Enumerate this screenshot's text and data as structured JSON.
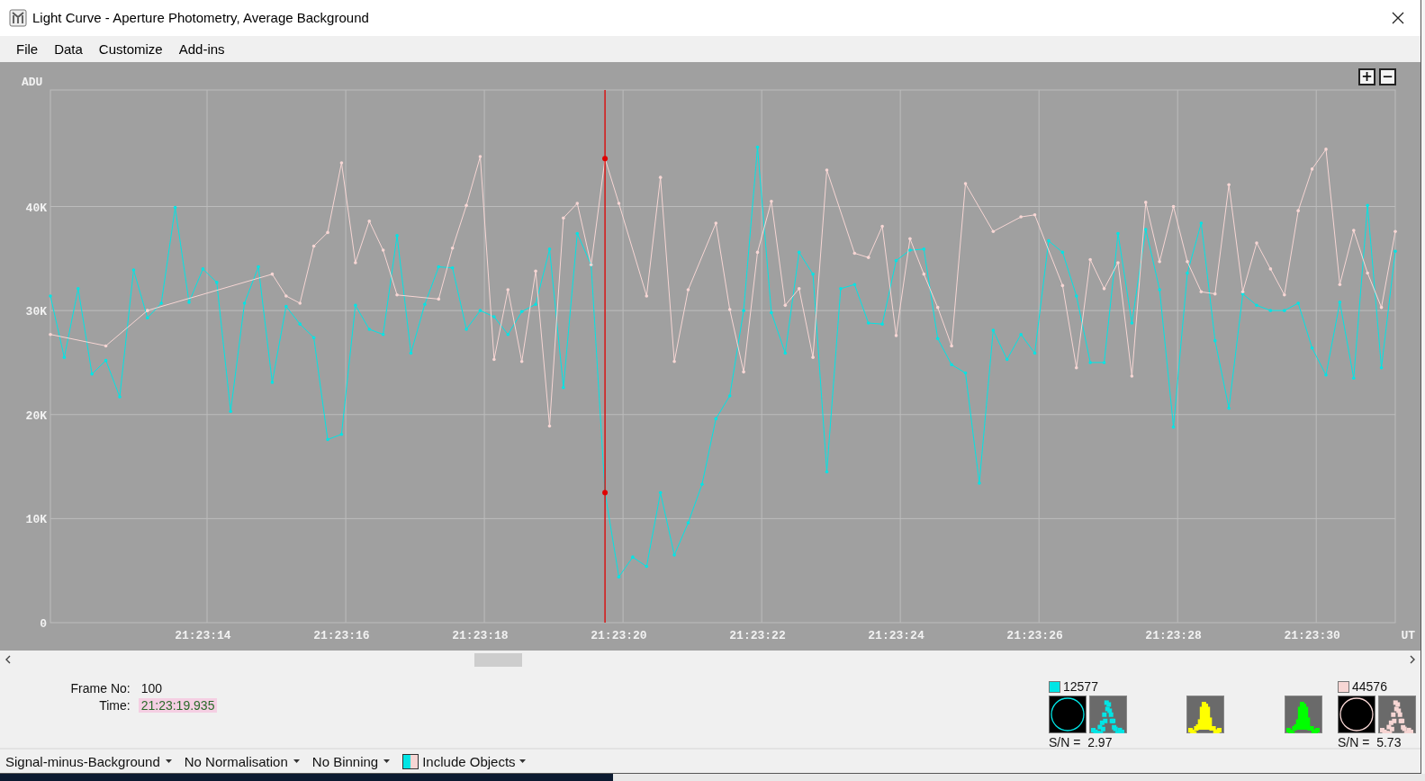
{
  "window": {
    "title": "Light Curve - Aperture Photometry, Average Background"
  },
  "menu": [
    {
      "label": "File"
    },
    {
      "label": "Data"
    },
    {
      "label": "Customize"
    },
    {
      "label": "Add-ins"
    }
  ],
  "chart": {
    "zoom_buttons": [
      "+",
      "−"
    ],
    "chart_data": {
      "type": "line",
      "xlabel": "UT",
      "ylabel": "ADU",
      "categories": [
        null,
        null,
        null,
        null,
        null,
        null,
        null,
        null,
        null,
        null,
        null,
        "21:23:14",
        null,
        null,
        null,
        null,
        null,
        null,
        null,
        null,
        null,
        "21:23:16",
        null,
        null,
        null,
        null,
        null,
        null,
        null,
        null,
        null,
        "21:23:18",
        null,
        null,
        null,
        null,
        null,
        null,
        null,
        null,
        null,
        "21:23:20",
        null,
        null,
        null,
        null,
        null,
        null,
        null,
        null,
        null,
        "21:23:22",
        null,
        null,
        null,
        null,
        null,
        null,
        null,
        null,
        null,
        "21:23:24",
        null,
        null,
        null,
        null,
        null,
        null,
        null,
        null,
        null,
        "21:23:26",
        null,
        null,
        null,
        null,
        null,
        null,
        null,
        null,
        null,
        "21:23:28",
        null,
        null,
        null,
        null,
        null,
        null,
        null,
        null,
        null,
        "21:23:30",
        null,
        null,
        null,
        null,
        null,
        null
      ],
      "series": [
        {
          "color": "#00e5e5",
          "values": [
            31400,
            25500,
            32100,
            23900,
            25200,
            21700,
            33900,
            29300,
            30700,
            39900,
            30800,
            34000,
            32700,
            20300,
            30700,
            34200,
            23100,
            30400,
            28700,
            27400,
            17600,
            18100,
            30500,
            28200,
            27700,
            37200,
            25900,
            30600,
            34200,
            34100,
            28200,
            30000,
            29400,
            27700,
            29900,
            30600,
            35900,
            22600,
            37400,
            34400,
            12500,
            4400,
            6300,
            5400,
            12500,
            6500,
            9600,
            13300,
            19600,
            21800,
            30000,
            45700,
            29800,
            25900,
            35600,
            33500,
            14500,
            32100,
            32500,
            28800,
            28700,
            34800,
            35800,
            35900,
            27300,
            24800,
            24000,
            13400,
            28100,
            25300,
            27700,
            25900,
            36700,
            35600,
            31400,
            25000,
            25000,
            37400,
            28800,
            37800,
            32000,
            18800,
            33600,
            38400,
            27100,
            20600,
            31600,
            30500,
            30000,
            30000,
            30700,
            26400,
            23800,
            30800,
            23500,
            40100,
            24500,
            35700
          ]
        },
        {
          "color": "#f7d6d4",
          "values": [
            27700,
            null,
            null,
            null,
            26600,
            null,
            null,
            30000,
            null,
            null,
            null,
            null,
            null,
            null,
            null,
            null,
            33500,
            31400,
            30700,
            36200,
            37500,
            44200,
            34600,
            38600,
            35800,
            31500,
            null,
            null,
            31100,
            36000,
            40100,
            44800,
            25300,
            32000,
            25100,
            33800,
            18900,
            38900,
            40300,
            34400,
            44600,
            40300,
            null,
            31400,
            42800,
            25100,
            32000,
            null,
            38400,
            30100,
            24100,
            35600,
            40500,
            30500,
            32100,
            25500,
            43500,
            null,
            35500,
            35100,
            38100,
            27600,
            36900,
            33500,
            30300,
            26600,
            42200,
            null,
            37600,
            null,
            39000,
            39200,
            null,
            32400,
            24500,
            34900,
            32100,
            34600,
            23700,
            40400,
            34700,
            40000,
            34700,
            31800,
            31600,
            42100,
            31800,
            36500,
            34000,
            31500,
            39600,
            43600,
            45500,
            32500,
            37700,
            33600,
            30300,
            37600
          ]
        }
      ],
      "ylim": [
        0,
        51200
      ],
      "yticks": [
        {
          "value": 0,
          "label": "0"
        },
        {
          "value": 10000,
          "label": "10K"
        },
        {
          "value": 20000,
          "label": "20K"
        },
        {
          "value": 30000,
          "label": "30K"
        },
        {
          "value": 40000,
          "label": "40K"
        }
      ],
      "grid": true
    }
  },
  "frame_info": {
    "frame_label": "Frame No:",
    "frame": "100",
    "time_label": "Time:",
    "time": "21:23:19.935"
  },
  "objects": [
    {
      "color": "#00e5e5",
      "reading": "12577",
      "sn_label": "S/N =",
      "sn": "2.97"
    },
    {
      "color": "#f7d6d4",
      "reading": "44576",
      "sn_label": "S/N =",
      "sn": "5.73"
    }
  ],
  "profiles": [
    {
      "color": "#ffff00"
    },
    {
      "color": "#00ff00"
    }
  ],
  "status_bar": [
    {
      "kind": "dropdown",
      "label": "Signal-minus-Background"
    },
    {
      "kind": "dropdown",
      "label": "No Normalisation"
    },
    {
      "kind": "dropdown",
      "label": "No Binning"
    },
    {
      "kind": "objects",
      "label": "Include Objects"
    }
  ]
}
